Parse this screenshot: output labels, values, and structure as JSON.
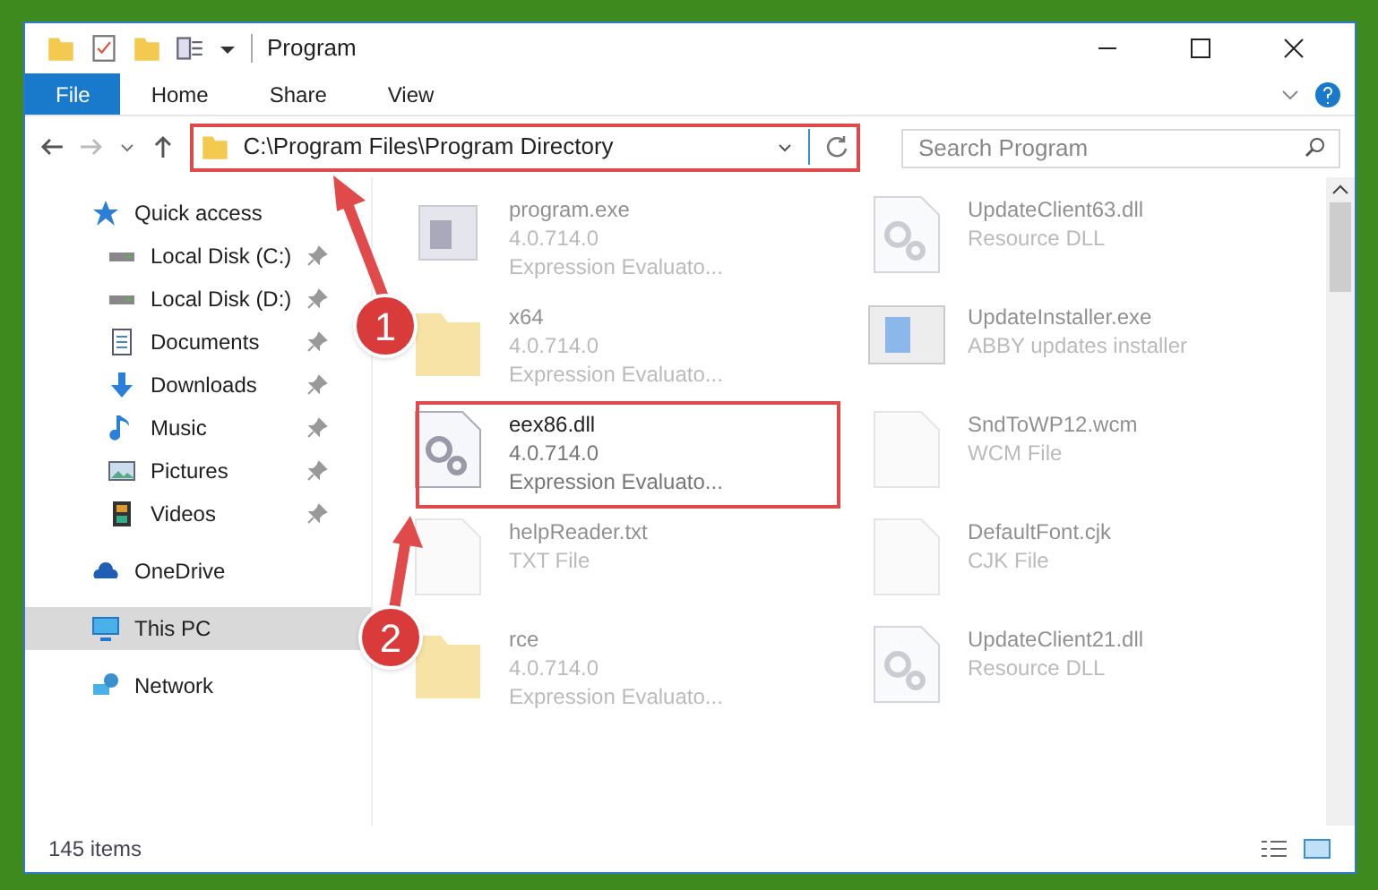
{
  "window": {
    "title": "Program"
  },
  "ribbon_tabs": [
    {
      "label": "File",
      "selected": true
    },
    {
      "label": "Home",
      "selected": false
    },
    {
      "label": "Share",
      "selected": false
    },
    {
      "label": "View",
      "selected": false
    }
  ],
  "address": {
    "value": "C:\\Program Files\\Program Directory"
  },
  "search": {
    "placeholder": "Search Program"
  },
  "nav": [
    {
      "label": "Quick access",
      "selected": false,
      "children": [
        {
          "label": "Local Disk (C:)",
          "pinned": true,
          "selected": false
        },
        {
          "label": "Local Disk (D:)",
          "pinned": true,
          "selected": false
        },
        {
          "label": "Documents",
          "pinned": true,
          "selected": false
        },
        {
          "label": "Downloads",
          "pinned": true,
          "selected": false
        },
        {
          "label": "Music",
          "pinned": true,
          "selected": false
        },
        {
          "label": "Pictures",
          "pinned": true,
          "selected": false
        },
        {
          "label": "Videos",
          "pinned": true,
          "selected": false
        }
      ]
    },
    {
      "label": "OneDrive",
      "selected": false
    },
    {
      "label": "This PC",
      "selected": true
    },
    {
      "label": "Network",
      "selected": false
    }
  ],
  "files": [
    {
      "name": "program.exe",
      "lines": [
        "4.0.714.0",
        "Expression Evaluato..."
      ],
      "kind": "app",
      "blurred": true
    },
    {
      "name": "UpdateClient63.dll",
      "lines": [
        "Resource DLL"
      ],
      "kind": "dll",
      "blurred": true
    },
    {
      "name": "x64",
      "lines": [
        "4.0.714.0",
        "Expression Evaluato..."
      ],
      "kind": "folder",
      "blurred": true
    },
    {
      "name": "UpdateInstaller.exe",
      "lines": [
        "ABBY updates installer"
      ],
      "kind": "installer",
      "blurred": true
    },
    {
      "name": "eex86.dll",
      "lines": [
        "4.0.714.0",
        "Expression Evaluato..."
      ],
      "kind": "dll",
      "blurred": false
    },
    {
      "name": "SndToWP12.wcm",
      "lines": [
        "WCM File"
      ],
      "kind": "plain",
      "blurred": true
    },
    {
      "name": "helpReader.txt",
      "lines": [
        "TXT File"
      ],
      "kind": "plain",
      "blurred": true
    },
    {
      "name": "DefaultFont.cjk",
      "lines": [
        "CJK File"
      ],
      "kind": "plain",
      "blurred": true
    },
    {
      "name": "rce",
      "lines": [
        "4.0.714.0",
        "Expression Evaluato..."
      ],
      "kind": "folder",
      "blurred": true
    },
    {
      "name": "UpdateClient21.dll",
      "lines": [
        "Resource DLL"
      ],
      "kind": "dll",
      "blurred": true
    }
  ],
  "status_bar": {
    "count": "145 items"
  },
  "annotations": [
    {
      "number": "1"
    },
    {
      "number": "2"
    }
  ]
}
